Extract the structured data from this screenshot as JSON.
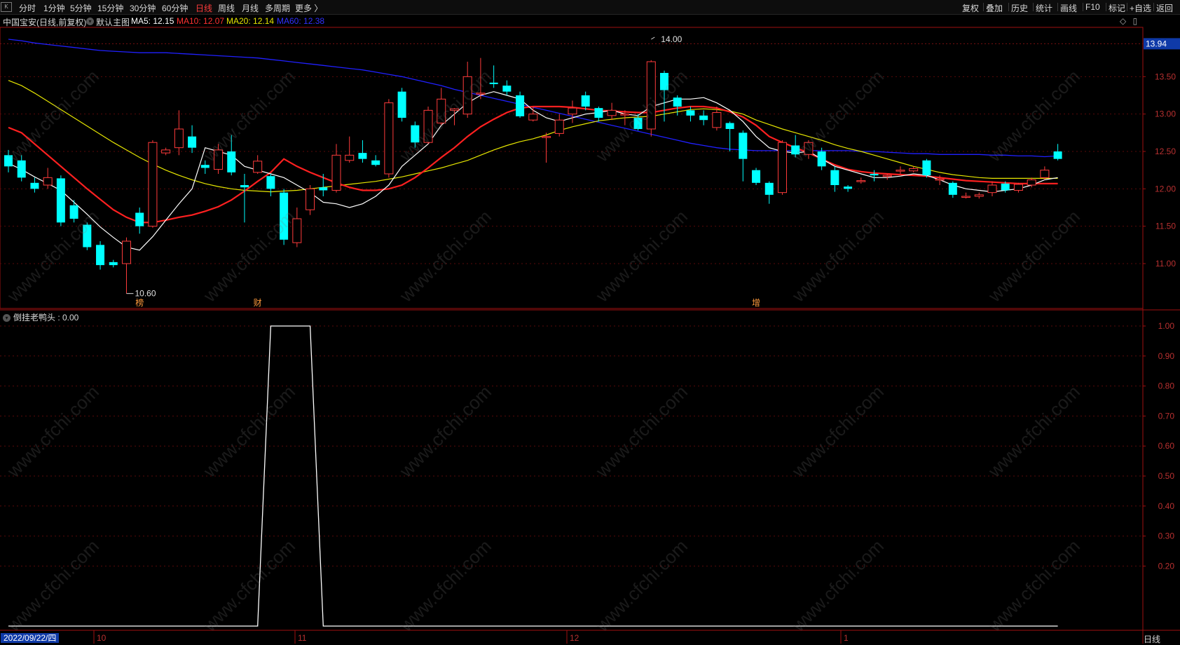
{
  "toolbar": {
    "periods": [
      "分时",
      "1分钟",
      "5分钟",
      "15分钟",
      "30分钟",
      "60分钟",
      "日线",
      "周线",
      "月线",
      "多周期",
      "更多 〉"
    ],
    "active_period": "日线",
    "right_tools": [
      "复权",
      "叠加",
      "历史",
      "统计",
      "画线",
      "F10",
      "标记",
      "+自选",
      "返回"
    ]
  },
  "stock": {
    "title": "中国宝安(日线,前复权)",
    "main_chart_label": "默认主图",
    "ma5": "MA5: 12.15",
    "ma10": "MA10: 12.07",
    "ma20": "MA20: 12.14",
    "ma60": "MA60: 12.38"
  },
  "colors": {
    "up": "#ff3b3b",
    "down": "#00ffff",
    "ma5": "#ffffff",
    "ma10": "#ff2020",
    "ma20": "#e6e600",
    "ma60": "#2020ff",
    "axis": "#a01010",
    "grid": "#5a0a0a"
  },
  "price_axis": {
    "ticks": [
      "13.50",
      "13.00",
      "12.50",
      "12.00",
      "11.50",
      "11.00"
    ],
    "current_price": "13.94"
  },
  "annotations": {
    "high": "14.00",
    "low": "10.60",
    "markers": [
      "榜",
      "财",
      "增"
    ]
  },
  "indicator": {
    "label": "倒挂老鸭头 : 0.00",
    "ticks": [
      "1.00",
      "0.90",
      "0.80",
      "0.70",
      "0.60",
      "0.50",
      "0.40",
      "0.30",
      "0.20"
    ]
  },
  "time_axis": {
    "current_date": "2022/09/22/四",
    "month_labels": [
      "10",
      "11",
      "12",
      "1"
    ],
    "period_label": "日线"
  },
  "watermark_text": "www.cfchi.com",
  "chart_data": {
    "type": "candlestick",
    "ylim": [
      10.4,
      14.15
    ],
    "candles": [
      [
        12.45,
        12.3,
        12.52,
        12.22
      ],
      [
        12.38,
        12.15,
        12.45,
        12.1
      ],
      [
        12.08,
        12.0,
        12.15,
        11.95
      ],
      [
        12.05,
        12.15,
        12.28,
        12.0
      ],
      [
        12.14,
        11.55,
        12.18,
        11.5
      ],
      [
        11.78,
        11.6,
        11.85,
        11.55
      ],
      [
        11.52,
        11.22,
        11.55,
        11.18
      ],
      [
        11.25,
        10.98,
        11.3,
        10.92
      ],
      [
        11.02,
        10.98,
        11.05,
        10.95
      ],
      [
        11.0,
        11.3,
        11.35,
        10.6
      ],
      [
        11.68,
        11.5,
        11.75,
        11.4
      ],
      [
        11.5,
        12.62,
        12.65,
        11.48
      ],
      [
        12.48,
        12.52,
        12.55,
        12.45
      ],
      [
        12.55,
        12.8,
        13.05,
        12.45
      ],
      [
        12.7,
        12.55,
        12.85,
        12.48
      ],
      [
        12.32,
        12.28,
        12.38,
        12.2
      ],
      [
        12.26,
        12.52,
        12.6,
        12.2
      ],
      [
        12.5,
        12.22,
        12.72,
        12.18
      ],
      [
        12.05,
        12.02,
        12.2,
        11.55
      ],
      [
        12.22,
        12.37,
        12.45,
        12.2
      ],
      [
        12.17,
        12.0,
        12.2,
        11.9
      ],
      [
        11.95,
        11.32,
        12.0,
        11.25
      ],
      [
        11.28,
        11.6,
        11.75,
        11.22
      ],
      [
        11.72,
        12.0,
        12.05,
        11.65
      ],
      [
        12.02,
        11.98,
        12.2,
        11.9
      ],
      [
        11.98,
        12.45,
        12.6,
        11.95
      ],
      [
        12.38,
        12.45,
        12.7,
        12.35
      ],
      [
        12.48,
        12.4,
        12.65,
        12.35
      ],
      [
        12.38,
        12.32,
        12.45,
        12.3
      ],
      [
        12.2,
        13.15,
        13.2,
        12.15
      ],
      [
        13.3,
        12.95,
        13.35,
        12.9
      ],
      [
        12.85,
        12.62,
        12.9,
        12.55
      ],
      [
        12.62,
        13.05,
        13.1,
        12.6
      ],
      [
        12.88,
        13.2,
        13.35,
        12.85
      ],
      [
        13.05,
        13.07,
        13.08,
        12.85
      ],
      [
        13.0,
        13.5,
        13.7,
        12.95
      ],
      [
        13.28,
        13.28,
        13.75,
        13.2
      ],
      [
        13.42,
        13.4,
        13.65,
        13.35
      ],
      [
        13.38,
        13.3,
        13.45,
        13.25
      ],
      [
        13.25,
        12.97,
        13.3,
        12.95
      ],
      [
        12.92,
        13.0,
        13.1,
        12.9
      ],
      [
        12.7,
        12.7,
        12.75,
        12.35
      ],
      [
        12.74,
        12.92,
        13.0,
        12.7
      ],
      [
        13.0,
        13.08,
        13.18,
        12.88
      ],
      [
        13.25,
        13.1,
        13.3,
        13.05
      ],
      [
        13.08,
        12.95,
        13.1,
        12.9
      ],
      [
        12.98,
        13.05,
        13.15,
        12.92
      ],
      [
        13.0,
        13.0,
        13.05,
        12.85
      ],
      [
        12.95,
        12.8,
        13.0,
        12.78
      ],
      [
        12.8,
        13.7,
        13.72,
        12.7
      ],
      [
        13.55,
        13.32,
        13.58,
        12.9
      ],
      [
        13.22,
        13.1,
        13.25,
        12.98
      ],
      [
        13.05,
        12.98,
        13.1,
        12.9
      ],
      [
        12.98,
        12.92,
        13.05,
        12.85
      ],
      [
        12.82,
        13.02,
        13.1,
        12.78
      ],
      [
        12.88,
        12.8,
        12.9,
        12.5
      ],
      [
        12.75,
        12.4,
        12.78,
        12.1
      ],
      [
        12.25,
        12.08,
        12.28,
        12.05
      ],
      [
        12.08,
        11.92,
        12.1,
        11.8
      ],
      [
        11.95,
        12.62,
        12.65,
        11.92
      ],
      [
        12.58,
        12.46,
        12.72,
        12.42
      ],
      [
        12.46,
        12.62,
        12.65,
        12.4
      ],
      [
        12.5,
        12.3,
        12.55,
        12.25
      ],
      [
        12.25,
        12.05,
        12.3,
        11.96
      ],
      [
        12.03,
        12.0,
        12.05,
        11.96
      ],
      [
        12.1,
        12.11,
        12.15,
        12.07
      ],
      [
        12.2,
        12.18,
        12.25,
        12.1
      ],
      [
        12.18,
        12.18,
        12.2,
        12.12
      ],
      [
        12.24,
        12.25,
        12.3,
        12.2
      ],
      [
        12.24,
        12.27,
        12.3,
        12.22
      ],
      [
        12.38,
        12.18,
        12.4,
        12.15
      ],
      [
        12.12,
        12.13,
        12.18,
        12.05
      ],
      [
        12.08,
        11.92,
        12.1,
        11.88
      ],
      [
        11.9,
        11.9,
        11.95,
        11.87
      ],
      [
        11.9,
        11.92,
        11.95,
        11.87
      ],
      [
        11.95,
        12.05,
        12.1,
        11.9
      ],
      [
        12.07,
        11.98,
        12.1,
        11.95
      ],
      [
        11.98,
        12.06,
        12.08,
        11.95
      ],
      [
        12.05,
        12.12,
        12.15,
        12.02
      ],
      [
        12.15,
        12.25,
        12.3,
        12.12
      ],
      [
        12.5,
        12.4,
        12.6,
        12.38
      ]
    ],
    "ma5": [
      12.34,
      12.26,
      12.16,
      12.07,
      11.98,
      11.82,
      11.66,
      11.49,
      11.35,
      11.22,
      11.18,
      11.36,
      11.58,
      11.8,
      12.0,
      12.55,
      12.5,
      12.45,
      12.3,
      12.25,
      12.2,
      12.15,
      12.05,
      11.95,
      11.82,
      11.8,
      11.75,
      11.8,
      11.9,
      12.05,
      12.3,
      12.45,
      12.6,
      12.85,
      13.0,
      13.15,
      13.25,
      13.3,
      13.25,
      13.2,
      13.05,
      12.95,
      12.9,
      12.95,
      13.0,
      13.02,
      13.05,
      13.0,
      12.98,
      13.1,
      13.15,
      13.2,
      13.2,
      13.22,
      13.15,
      13.05,
      12.9,
      12.7,
      12.55,
      12.5,
      12.48,
      12.5,
      12.4,
      12.3,
      12.25,
      12.2,
      12.15,
      12.15,
      12.17,
      12.2,
      12.18,
      12.12,
      12.05,
      12.0,
      11.98,
      11.96,
      11.98,
      12.0,
      12.05,
      12.12,
      12.15
    ],
    "ma10": [
      12.82,
      12.75,
      12.6,
      12.45,
      12.3,
      12.15,
      12.0,
      11.86,
      11.72,
      11.62,
      11.55,
      11.55,
      11.58,
      11.62,
      11.65,
      11.7,
      11.76,
      11.85,
      11.97,
      12.1,
      12.22,
      12.4,
      12.3,
      12.22,
      12.15,
      12.08,
      12.02,
      11.98,
      11.98,
      12.0,
      12.05,
      12.15,
      12.28,
      12.42,
      12.55,
      12.7,
      12.83,
      12.93,
      13.02,
      13.08,
      13.1,
      13.1,
      13.1,
      13.09,
      13.07,
      13.05,
      13.04,
      13.03,
      13.02,
      13.02,
      13.05,
      13.08,
      13.1,
      13.1,
      13.08,
      13.03,
      12.96,
      12.85,
      12.7,
      12.62,
      12.55,
      12.48,
      12.4,
      12.32,
      12.26,
      12.23,
      12.21,
      12.2,
      12.19,
      12.18,
      12.17,
      12.15,
      12.13,
      12.11,
      12.1,
      12.09,
      12.08,
      12.07,
      12.07,
      12.07,
      12.07
    ],
    "ma20": [
      13.45,
      13.38,
      13.28,
      13.17,
      13.06,
      12.95,
      12.84,
      12.73,
      12.62,
      12.52,
      12.42,
      12.33,
      12.25,
      12.18,
      12.12,
      12.07,
      12.03,
      12.0,
      11.98,
      11.97,
      11.96,
      11.97,
      11.98,
      12.0,
      12.02,
      12.04,
      12.06,
      12.08,
      12.1,
      12.13,
      12.16,
      12.2,
      12.24,
      12.28,
      12.33,
      12.38,
      12.45,
      12.52,
      12.58,
      12.63,
      12.67,
      12.72,
      12.78,
      12.83,
      12.87,
      12.91,
      12.93,
      12.95,
      12.96,
      12.97,
      13.0,
      13.03,
      13.06,
      13.07,
      13.06,
      13.04,
      13.0,
      12.92,
      12.86,
      12.8,
      12.75,
      12.7,
      12.65,
      12.59,
      12.54,
      12.5,
      12.45,
      12.4,
      12.35,
      12.3,
      12.26,
      12.22,
      12.19,
      12.17,
      12.15,
      12.14,
      12.14,
      12.14,
      12.14,
      12.14,
      12.14
    ],
    "ma60": [
      14.0,
      13.98,
      13.95,
      13.93,
      13.91,
      13.89,
      13.87,
      13.85,
      13.84,
      13.83,
      13.82,
      13.82,
      13.82,
      13.81,
      13.8,
      13.79,
      13.78,
      13.77,
      13.76,
      13.75,
      13.73,
      13.71,
      13.69,
      13.67,
      13.65,
      13.63,
      13.61,
      13.59,
      13.56,
      13.53,
      13.5,
      13.46,
      13.42,
      13.38,
      13.33,
      13.29,
      13.25,
      13.21,
      13.17,
      13.13,
      13.09,
      13.05,
      13.01,
      12.97,
      12.93,
      12.89,
      12.85,
      12.81,
      12.77,
      12.73,
      12.69,
      12.65,
      12.61,
      12.58,
      12.55,
      12.53,
      12.52,
      12.51,
      12.51,
      12.51,
      12.51,
      12.51,
      12.51,
      12.51,
      12.51,
      12.5,
      12.5,
      12.49,
      12.48,
      12.47,
      12.47,
      12.46,
      12.46,
      12.46,
      12.46,
      12.45,
      12.45,
      12.44,
      12.44,
      12.43,
      12.44
    ],
    "indicator": {
      "ylim": [
        0,
        1.0
      ],
      "segments": [
        [
          0,
          0
        ],
        [
          19,
          0
        ],
        [
          20,
          1
        ],
        [
          23,
          1
        ],
        [
          24,
          0
        ],
        [
          80,
          0
        ]
      ]
    }
  }
}
